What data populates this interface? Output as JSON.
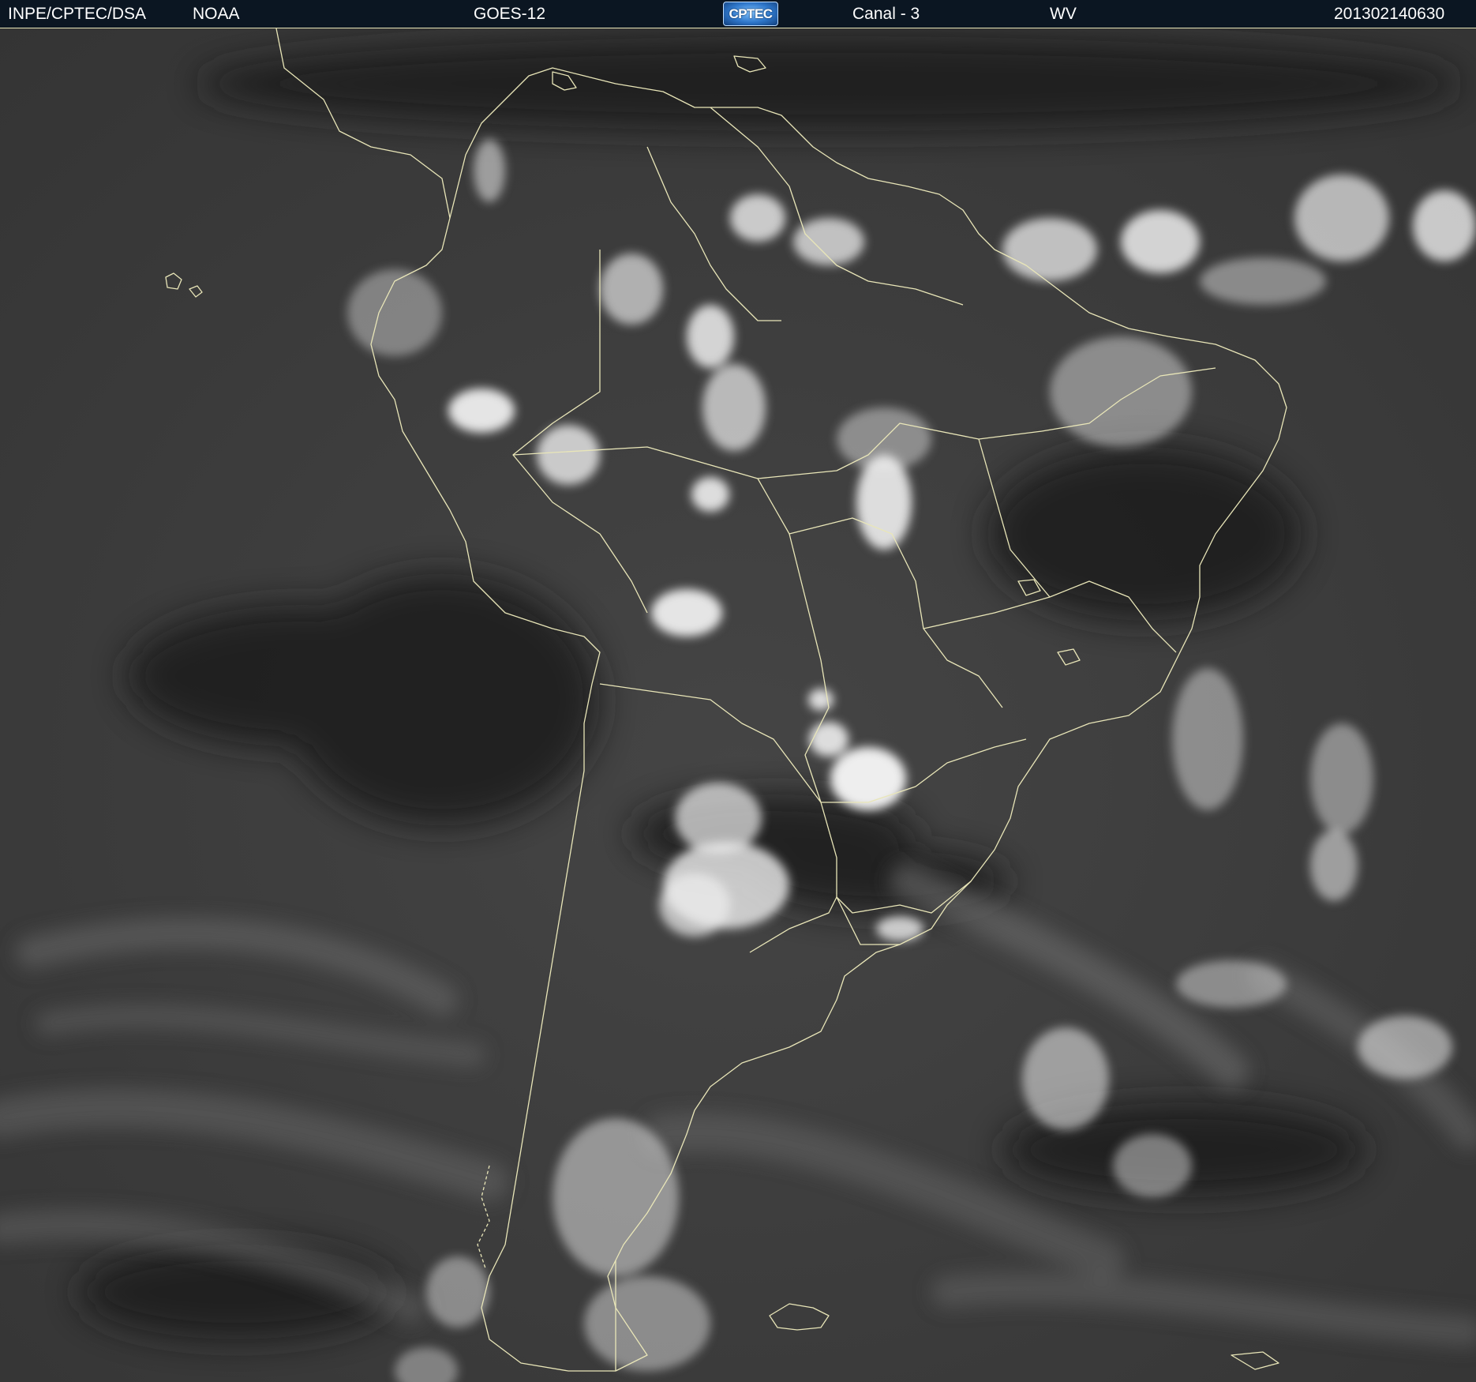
{
  "header": {
    "source": "INPE/CPTEC/DSA",
    "agency": "NOAA",
    "satellite": "GOES-12",
    "logo_text": "CPTEC",
    "channel": "Canal - 3",
    "band": "WV",
    "timestamp": "201302140630"
  },
  "image": {
    "type": "water-vapor satellite image",
    "region": "South America",
    "palette": {
      "dry_dark": "#1a1a1a",
      "background": "#3c3c3c",
      "moist_light": "#8a8a8a",
      "cloud_top": "#f4f4f4",
      "coastline": "#e9e6b8"
    },
    "border_icon": "coastline-outline"
  }
}
